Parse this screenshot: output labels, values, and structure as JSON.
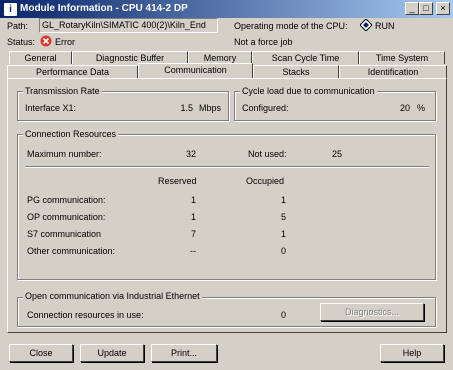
{
  "window": {
    "title": "Module Information - CPU 414-2 DP",
    "app_icon": "i",
    "controls": [
      "_",
      "□",
      "×"
    ]
  },
  "header": {
    "path_label": "Path:",
    "path_value": "GL_RotaryKiln\\SIMATIC 400(2)\\Kiln_End",
    "status_label": "Status:",
    "status_value": "Error",
    "op_mode_label": "Operating mode of the  CPU:",
    "op_mode_value": "RUN",
    "force_text": "Not a force job"
  },
  "tabs_back": [
    "General",
    "Diagnostic Buffer",
    "Memory",
    "Scan Cycle Time",
    "Time System"
  ],
  "tabs_front": [
    "Performance Data",
    "Communication",
    "Stacks",
    "Identification"
  ],
  "active_tab": "Communication",
  "transmission": {
    "title": "Transmission Rate",
    "label": "Interface X1:",
    "value": "1.5",
    "unit": "Mbps"
  },
  "cycle_load": {
    "title": "Cycle load due to communication",
    "label": "Configured:",
    "value": "20",
    "unit": "%"
  },
  "resources": {
    "title": "Connection Resources",
    "max_label": "Maximum number:",
    "max_value": "32",
    "notused_label": "Not used:",
    "notused_value": "25",
    "col_reserved": "Reserved",
    "col_occupied": "Occupied",
    "rows": [
      {
        "label": "PG communication:",
        "reserved": "1",
        "occupied": "1"
      },
      {
        "label": "OP communication:",
        "reserved": "1",
        "occupied": "5"
      },
      {
        "label": "S7 communication",
        "reserved": "7",
        "occupied": "1"
      },
      {
        "label": "Other communication:",
        "reserved": "--",
        "occupied": "0"
      }
    ]
  },
  "ethernet": {
    "title": "Open communication via Industrial Ethernet",
    "label": "Connection resources in use:",
    "value": "0",
    "diag_button": "Diagnostics..."
  },
  "buttons": {
    "close": "Close",
    "update": "Update",
    "print": "Print...",
    "help": "Help"
  },
  "colors": {
    "title_start": "#0a246a",
    "title_end": "#a6caf0",
    "error_red": "#d83a2a",
    "face": "#d4d0c8"
  }
}
